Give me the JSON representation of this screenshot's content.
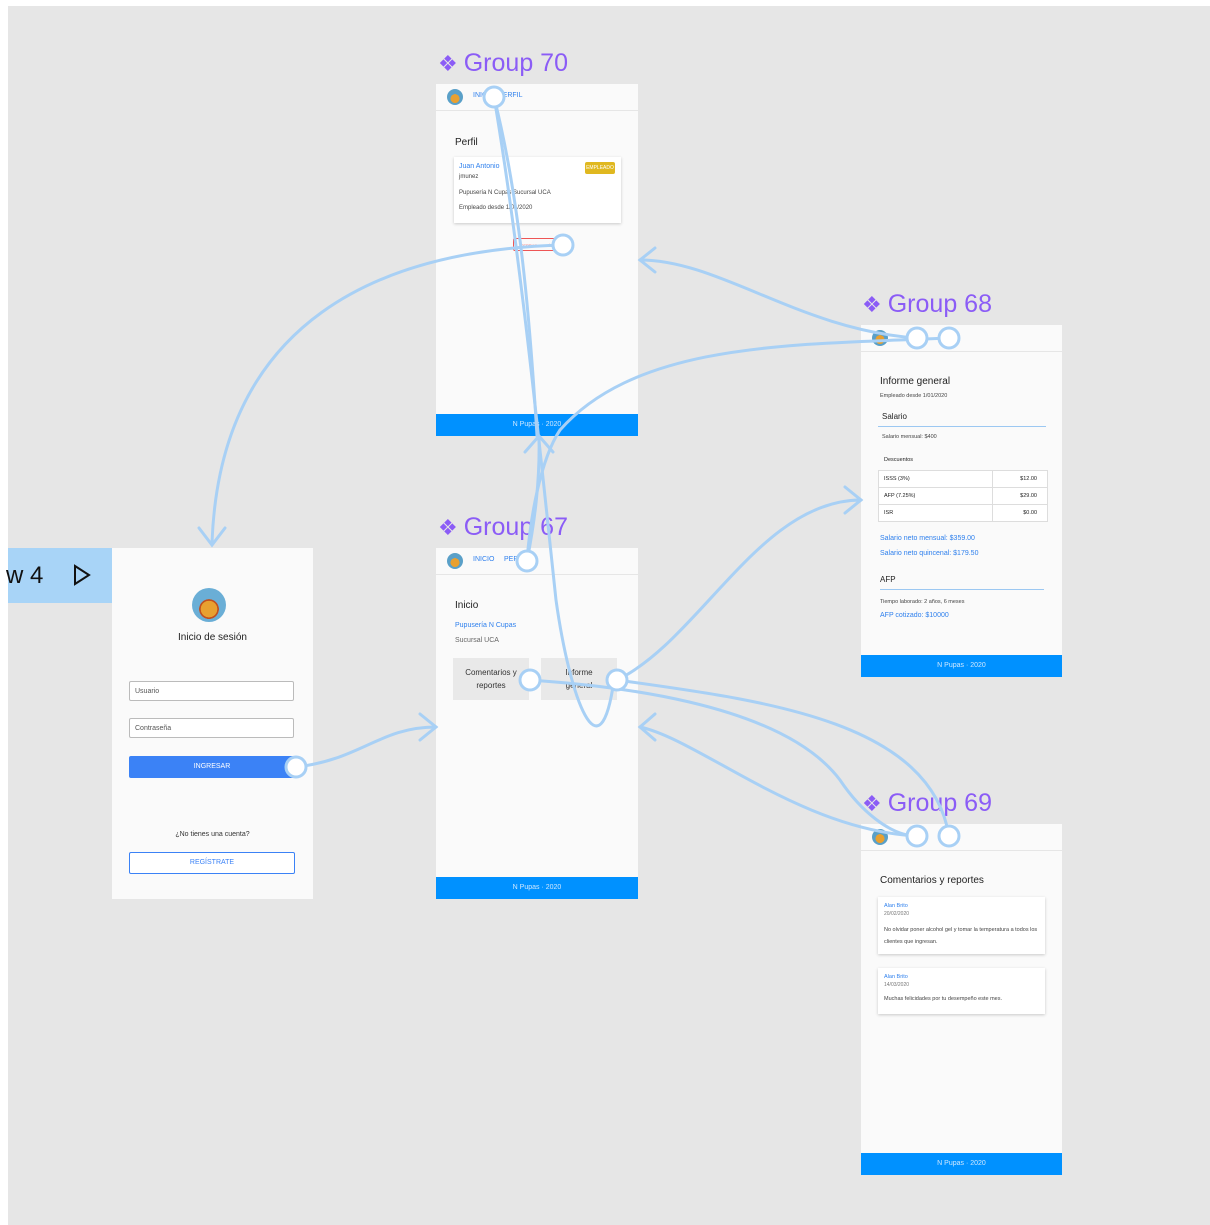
{
  "canvas": {
    "background": "#e6e6e6",
    "accent": "#8b5cf6",
    "link_color": "#a8d0f5",
    "footer_color": "#0091ff"
  },
  "flow_tab": {
    "label": "w 4",
    "icon": "play-icon"
  },
  "groups": {
    "g70": {
      "title": "Group 70",
      "icon": "component-icon"
    },
    "g68": {
      "title": "Group 68",
      "icon": "component-icon"
    },
    "g67": {
      "title": "Group 67",
      "icon": "component-icon"
    },
    "g69": {
      "title": "Group 69",
      "icon": "component-icon"
    }
  },
  "login": {
    "title": "Inicio de sesión",
    "user_placeholder": "Usuario",
    "password_placeholder": "Contraseña",
    "submit_label": "INGRESAR",
    "no_account_text": "¿No tienes una cuenta?",
    "register_label": "REGÍSTRATE"
  },
  "nav": {
    "home_label": "INICIO",
    "profile_label": "PERFIL"
  },
  "footer_text": "N Pupas · 2020",
  "home": {
    "title": "Inicio",
    "company": "Pupusería N Cupas",
    "branch": "Sucursal UCA",
    "tile_comments": "Comentarios y reportes",
    "tile_report": "Informe general"
  },
  "profile": {
    "title": "Perfil",
    "name": "Juan Antonio",
    "username": "jmunez",
    "workplace": "Pupusería N Cupas Sucursal UCA",
    "since": "Empleado desde 1/01/2020",
    "badge": "EMPLEADO",
    "logout_label": "CERRAR SESIÓN"
  },
  "report": {
    "title": "Informe general",
    "since": "Empleado desde 1/01/2020",
    "salary_heading": "Salario",
    "monthly_salary": "Salario mensual: $400",
    "discounts_heading": "Descuentos",
    "discounts": [
      {
        "label": "ISSS (3%)",
        "value": "$12.00"
      },
      {
        "label": "AFP (7.25%)",
        "value": "$29.00"
      },
      {
        "label": "ISR",
        "value": "$0.00"
      }
    ],
    "net_monthly": "Salario neto mensual: $359.00",
    "net_biweekly": "Salario neto quincenal: $179.50",
    "afp_heading": "AFP",
    "time_worked": "Tiempo laborado: 2 años, 6 meses",
    "afp_quoted": "AFP cotizado: $10000"
  },
  "comments": {
    "title": "Comentarios y reportes",
    "items": [
      {
        "author": "Alan Brito",
        "date": "20/02/2020",
        "text": "No olvidar poner alcohol gel y tomar la temperatura a todos los clientes que ingresan."
      },
      {
        "author": "Alan Brito",
        "date": "14/03/2020",
        "text": "Muchas felicidades por tu desempeño este mes."
      }
    ]
  }
}
